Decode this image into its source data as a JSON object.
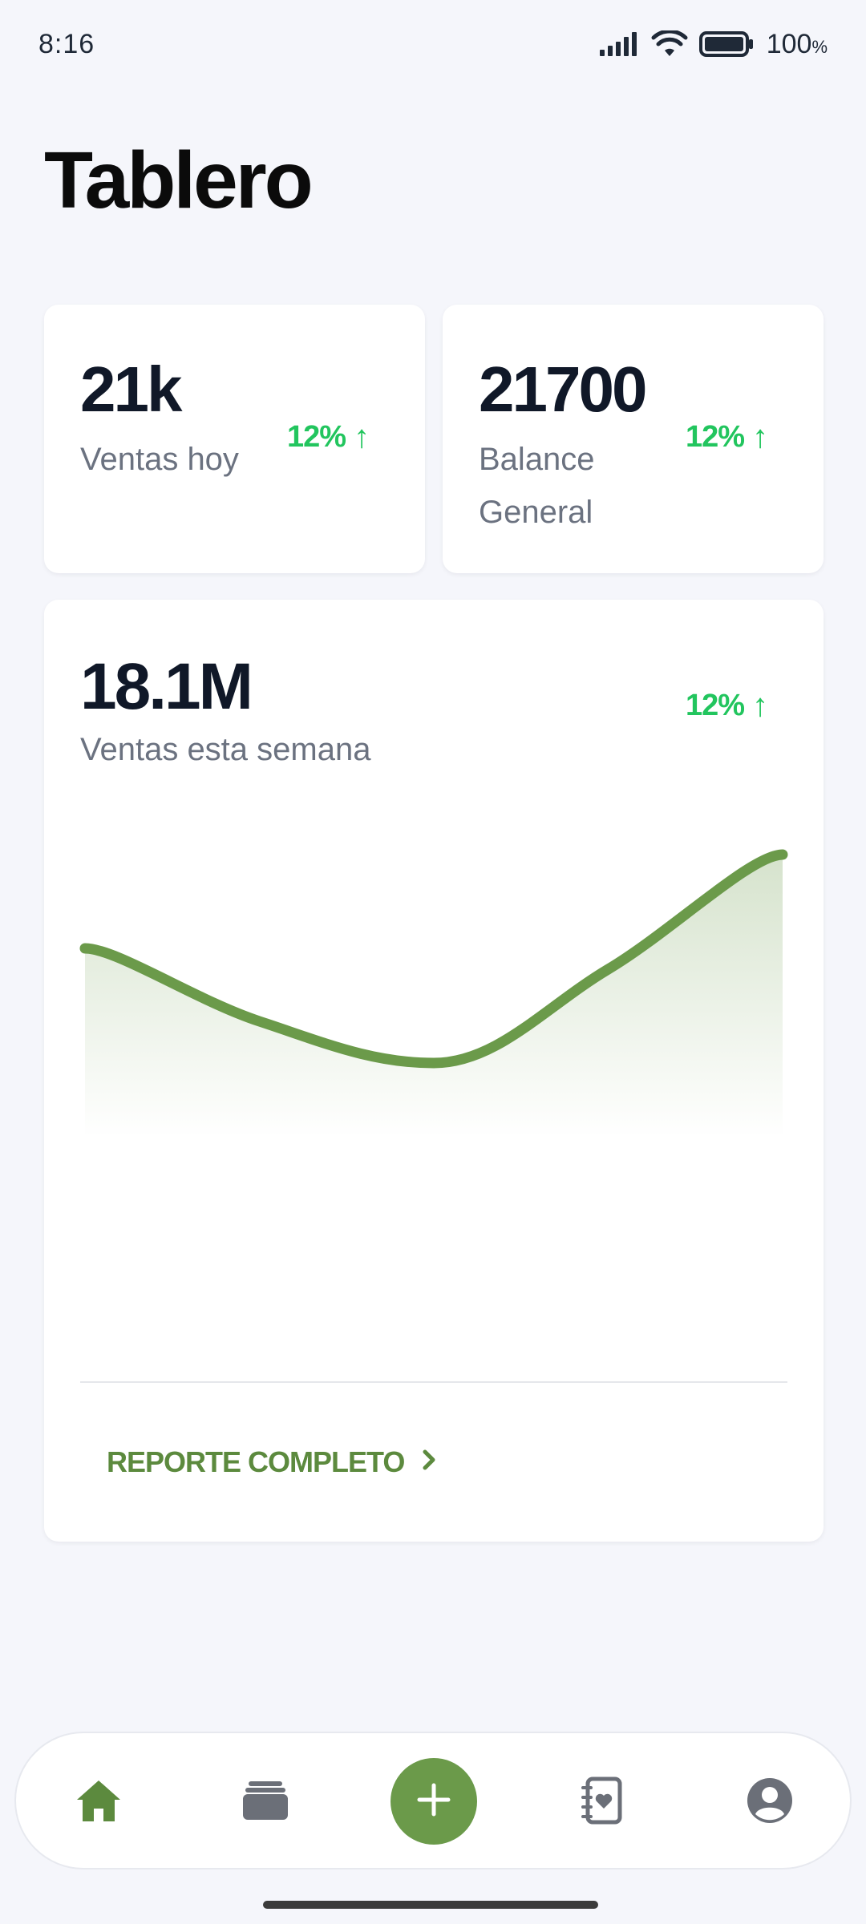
{
  "status_bar": {
    "time": "8:16",
    "battery": "100",
    "battery_unit": "%"
  },
  "title": "Tablero",
  "cards": [
    {
      "value": "21k",
      "label": "Ventas hoy",
      "delta": "12%",
      "delta_direction": "up"
    },
    {
      "value": "21700",
      "label": "Balance General",
      "delta": "12%",
      "delta_direction": "up"
    }
  ],
  "week_card": {
    "value": "18.1M",
    "label": "Ventas esta semana",
    "delta": "12%",
    "delta_direction": "up",
    "link_label": "REPORTE COMPLETO"
  },
  "chart_data": {
    "type": "area",
    "x": [
      0,
      1,
      2,
      3,
      4
    ],
    "values": [
      0.55,
      0.2,
      0.0,
      0.45,
      1.0
    ],
    "title": "",
    "xlabel": "",
    "ylabel": "",
    "grid": false,
    "line_color": "#6b9a4a",
    "fill_color": "#6b9a4a"
  },
  "nav": {
    "items": [
      {
        "name": "home-icon",
        "active": true
      },
      {
        "name": "wallet-icon",
        "active": false
      },
      {
        "name": "add-icon",
        "active": false
      },
      {
        "name": "contact-book-icon",
        "active": false
      },
      {
        "name": "user-icon",
        "active": false
      }
    ]
  },
  "colors": {
    "accent": "#6b9a4a",
    "positive": "#22c55e",
    "background": "#f5f6fb"
  }
}
